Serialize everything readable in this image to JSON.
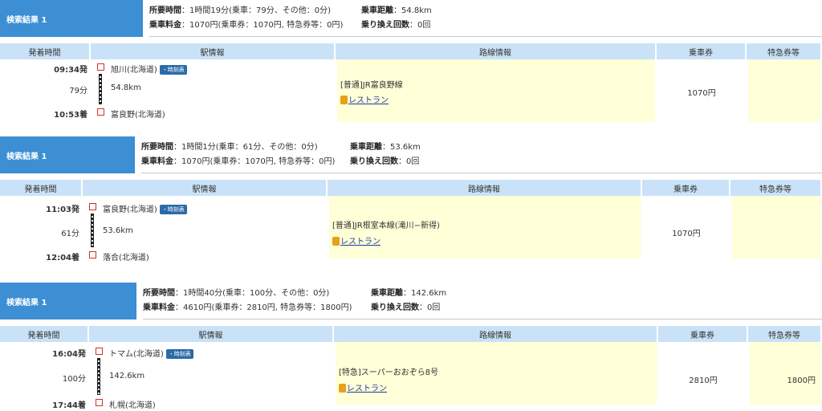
{
  "results": [
    {
      "title": "検索結果 1",
      "summary": {
        "time_label": "所要時間",
        "time_value": "：1時間19分(乗車：79分、その他：0分)",
        "fare_label": "乗車料金",
        "fare_value": "：1070円(乗車券：1070円, 特急券等：0円)",
        "dist_label": "乗車距離",
        "dist_value": "：54.8km",
        "transfer_label": "乗り換え回数",
        "transfer_value": "：0回"
      },
      "headers": {
        "time": "発着時間",
        "station": "駅情報",
        "route": "路線情報",
        "ticket": "乗車券",
        "express": "特急券等"
      },
      "dep_time": "09:34発",
      "dep_station": "旭川(北海道)",
      "badge": "・時刻表",
      "duration": "79分",
      "distance": "54.8km",
      "arr_time": "10:53着",
      "arr_station": "富良野(北海道)",
      "route": "[普通]JR富良野線",
      "restaurant": "レストラン",
      "ticket_fare": "1070円",
      "express_fare": ""
    },
    {
      "title": "検索結果 1",
      "summary": {
        "time_label": "所要時間",
        "time_value": "：1時間1分(乗車：61分、その他：0分)",
        "fare_label": "乗車料金",
        "fare_value": "：1070円(乗車券：1070円, 特急券等：0円)",
        "dist_label": "乗車距離",
        "dist_value": "：53.6km",
        "transfer_label": "乗り換え回数",
        "transfer_value": "：0回"
      },
      "headers": {
        "time": "発着時間",
        "station": "駅情報",
        "route": "路線情報",
        "ticket": "乗車券",
        "express": "特急券等"
      },
      "dep_time": "11:03発",
      "dep_station": "富良野(北海道)",
      "badge": "・時刻表",
      "duration": "61分",
      "distance": "53.6km",
      "arr_time": "12:04着",
      "arr_station": "落合(北海道)",
      "route": "[普通]JR根室本線(滝川−新得)",
      "restaurant": "レストラン",
      "ticket_fare": "1070円",
      "express_fare": ""
    },
    {
      "title": "検索結果 1",
      "summary": {
        "time_label": "所要時間",
        "time_value": "：1時間40分(乗車：100分、その他：0分)",
        "fare_label": "乗車料金",
        "fare_value": "：4610円(乗車券：2810円, 特急券等：1800円)",
        "dist_label": "乗車距離",
        "dist_value": "：142.6km",
        "transfer_label": "乗り換え回数",
        "transfer_value": "：0回"
      },
      "headers": {
        "time": "発着時間",
        "station": "駅情報",
        "route": "路線情報",
        "ticket": "乗車券",
        "express": "特急券等"
      },
      "dep_time": "16:04発",
      "dep_station": "トマム(北海道)",
      "badge": "・時刻表",
      "duration": "100分",
      "distance": "142.6km",
      "arr_time": "17:44着",
      "arr_station": "札幌(北海道)",
      "route": "[特急]スーパーおおぞら8号",
      "restaurant": "レストラン",
      "ticket_fare": "2810円",
      "express_fare": "1800円"
    }
  ]
}
